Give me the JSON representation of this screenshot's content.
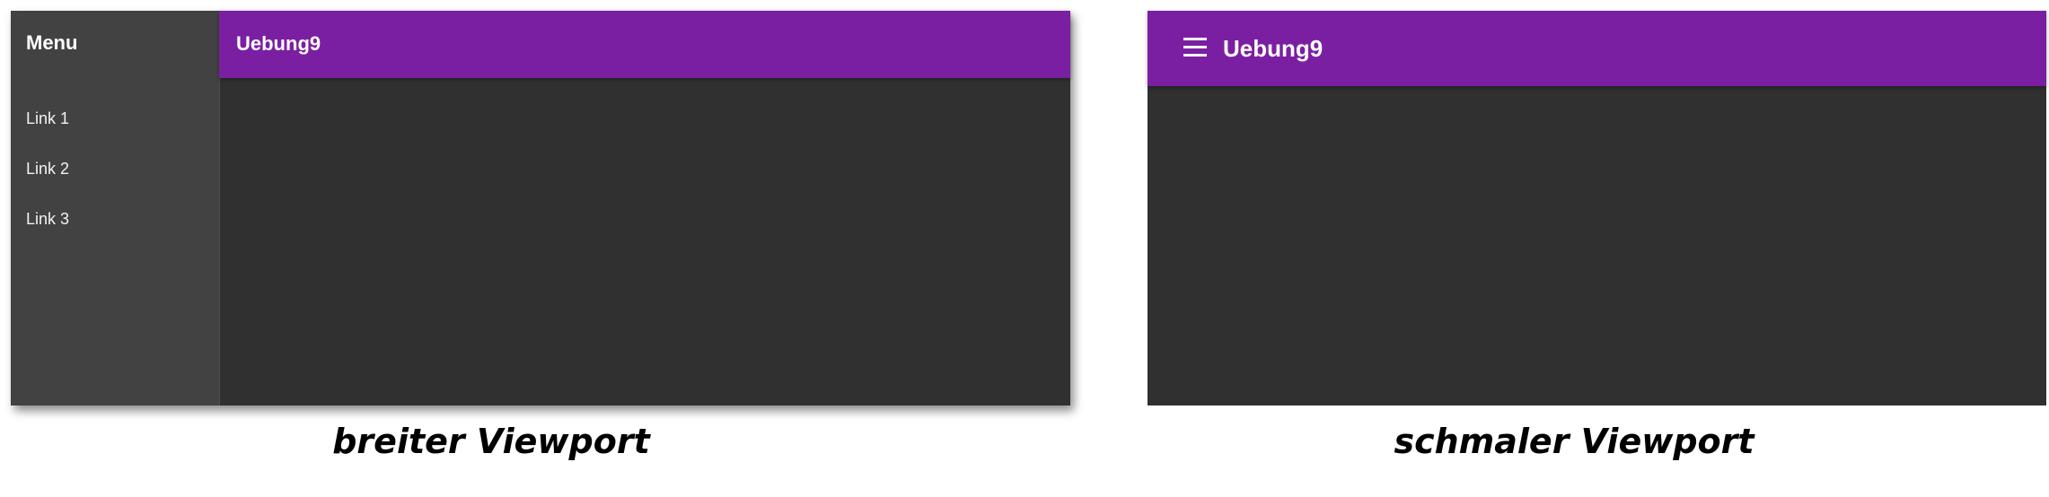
{
  "wide_viewport": {
    "sidebar": {
      "title": "Menu",
      "links": [
        {
          "label": "Link 1"
        },
        {
          "label": "Link 2"
        },
        {
          "label": "Link 3"
        }
      ]
    },
    "toolbar": {
      "title": "Uebung9"
    },
    "caption": "breiter Viewport"
  },
  "narrow_viewport": {
    "toolbar": {
      "menu_icon": "hamburger-menu-icon",
      "title": "Uebung9"
    },
    "caption": "schmaler Viewport"
  },
  "colors": {
    "toolbar": "#7b1fa2",
    "sidebar": "#424242",
    "content": "#303030",
    "text": "#ffffff"
  }
}
